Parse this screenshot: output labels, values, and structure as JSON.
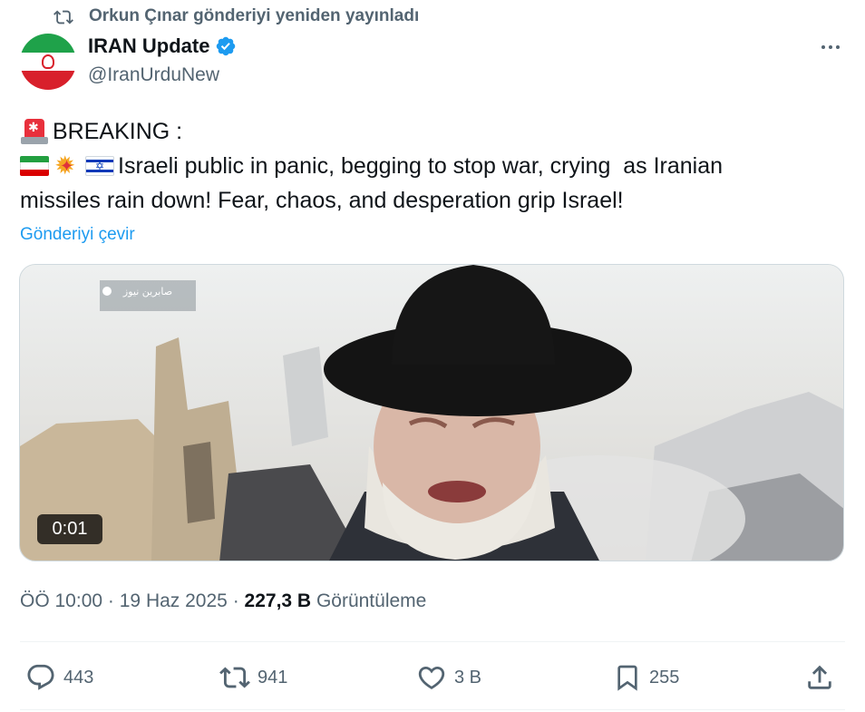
{
  "repost": {
    "text": "Orkun Çınar gönderiyi yeniden yayınladı"
  },
  "author": {
    "name": "IRAN Update",
    "handle": "@IranUrduNew"
  },
  "tweet": {
    "line1": "BREAKING :",
    "line2": "Israeli public in panic, begging to stop war, crying  as Iranian",
    "line3": "missiles rain down! Fear, chaos, and desperation grip Israel!",
    "emojis": [
      "siren-emoji",
      "iran-flag-emoji",
      "explosion-emoji",
      "israel-flag-emoji"
    ]
  },
  "translate_label": "Gönderiyi çevir",
  "media": {
    "duration": "0:01",
    "watermark": "صابرین نیوز"
  },
  "meta": {
    "time": "ÖÖ 10:00",
    "sep1": "·",
    "date": "19 Haz 2025",
    "sep2": "·",
    "views": "227,3 B",
    "views_label": "Görüntüleme"
  },
  "actions": {
    "replies": "443",
    "reposts": "941",
    "likes": "3 B",
    "bookmarks": "255"
  },
  "colors": {
    "link": "#1d9bf0",
    "secondary_text": "#536471",
    "primary_text": "#0f1419",
    "verified": "#1d9bf0"
  }
}
